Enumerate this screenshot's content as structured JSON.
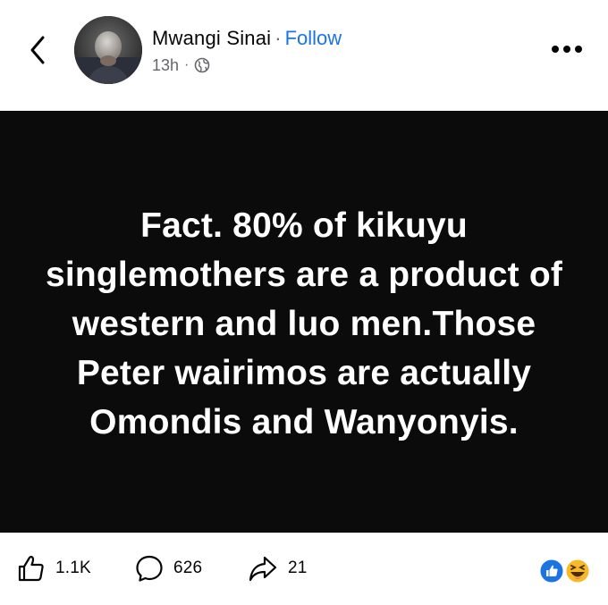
{
  "header": {
    "author_name": "Mwangi Sinai",
    "separator": "·",
    "follow_label": "Follow",
    "timestamp": "13h",
    "meta_dot": "·",
    "audience_icon": "globe-icon",
    "back_icon": "chevron-left-icon",
    "more_icon": "more-horizontal-icon"
  },
  "post": {
    "text": "Fact. 80% of kikuyu singlemothers are a product of western and luo men.Those Peter wairimos are actually Omondis and Wanyonyis.",
    "background_color": "#0b0b0b",
    "text_color": "#ffffff"
  },
  "footer": {
    "likes": "1.1K",
    "comments": "626",
    "shares": "21",
    "reactions": [
      "like-reaction-icon",
      "haha-reaction-icon"
    ]
  },
  "colors": {
    "accent": "#1b74e4",
    "muted": "#65676b"
  }
}
